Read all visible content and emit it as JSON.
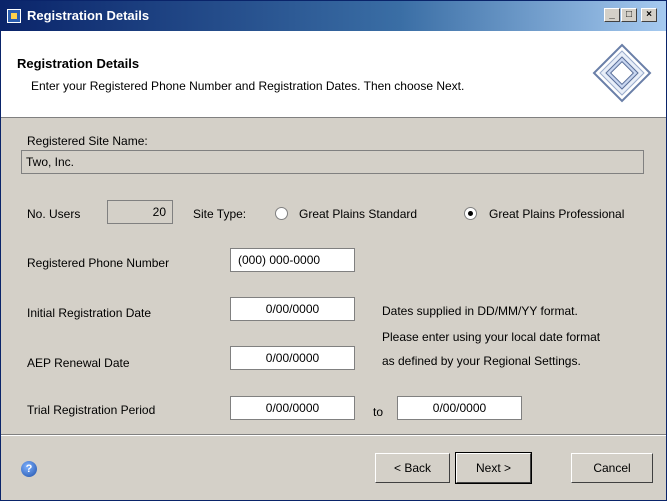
{
  "window": {
    "title": "Registration Details"
  },
  "header": {
    "title": "Registration Details",
    "subtitle": "Enter your Registered Phone Number and Registration Dates. Then choose Next."
  },
  "site": {
    "label": "Registered Site Name:",
    "value": "Two, Inc."
  },
  "users": {
    "label": "No. Users",
    "value": "20"
  },
  "site_type": {
    "label": "Site Type:",
    "options": [
      "Great Plains Standard",
      "Great Plains Professional"
    ],
    "selected": "Great Plains Professional"
  },
  "phone": {
    "label": "Registered Phone Number",
    "value": "(000) 000-0000"
  },
  "initial_date": {
    "label": "Initial Registration Date",
    "value": "0/00/0000"
  },
  "aep_date": {
    "label": "AEP Renewal Date",
    "value": "0/00/0000"
  },
  "trial": {
    "label": "Trial Registration Period",
    "from": "0/00/0000",
    "to_label": "to",
    "to": "0/00/0000"
  },
  "note": {
    "line1": "Dates supplied in DD/MM/YY format.",
    "line2": "Please enter using  your local date format",
    "line3": "as defined by your Regional Settings."
  },
  "buttons": {
    "back": "< Back",
    "next": "Next >",
    "cancel": "Cancel"
  },
  "colors": {
    "titlebar": "#0a246a",
    "dialog": "#d4d0c8"
  }
}
